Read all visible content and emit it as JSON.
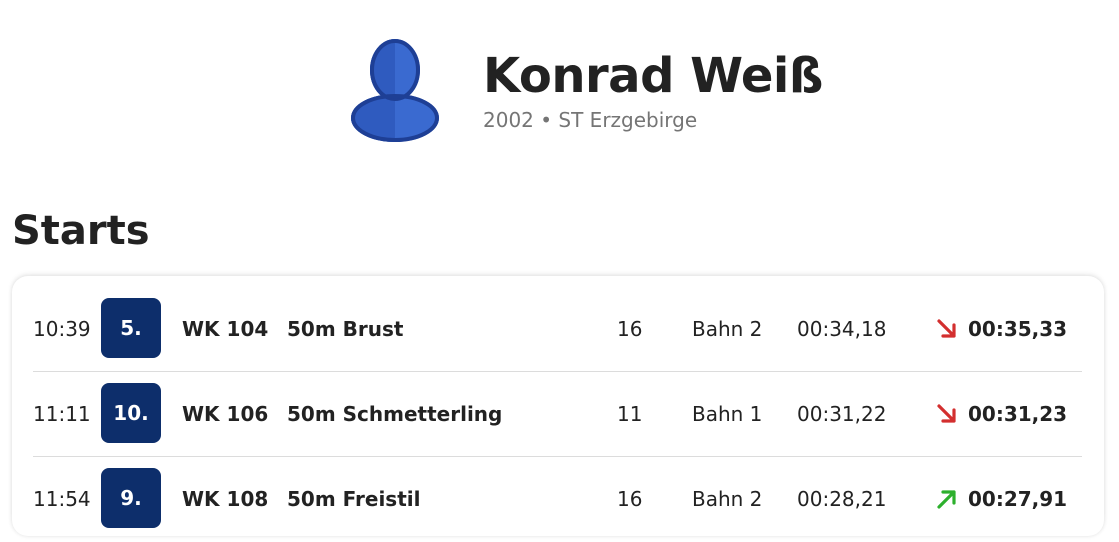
{
  "athlete": {
    "name": "Konrad Weiß",
    "subtitle": "2002 • ST Erzgebirge",
    "avatar_icon": "user-silhouette-icon"
  },
  "section": {
    "title": "Starts"
  },
  "colors": {
    "rank_badge": "#0d2e6b",
    "trend_down": "#d32f2f",
    "trend_up": "#2db02d",
    "avatar": "#2f5bbf"
  },
  "starts": [
    {
      "time": "10:39",
      "rank": "5.",
      "wk": "WK 104",
      "discipline": "50m Brust",
      "age_class": "16",
      "lane": "Bahn 2",
      "entry_time": "00:34,18",
      "trend": "down",
      "result": "00:35,33"
    },
    {
      "time": "11:11",
      "rank": "10.",
      "wk": "WK 106",
      "discipline": "50m Schmetterling",
      "age_class": "11",
      "lane": "Bahn 1",
      "entry_time": "00:31,22",
      "trend": "down",
      "result": "00:31,23"
    },
    {
      "time": "11:54",
      "rank": "9.",
      "wk": "WK 108",
      "discipline": "50m Freistil",
      "age_class": "16",
      "lane": "Bahn 2",
      "entry_time": "00:28,21",
      "trend": "up",
      "result": "00:27,91"
    }
  ]
}
